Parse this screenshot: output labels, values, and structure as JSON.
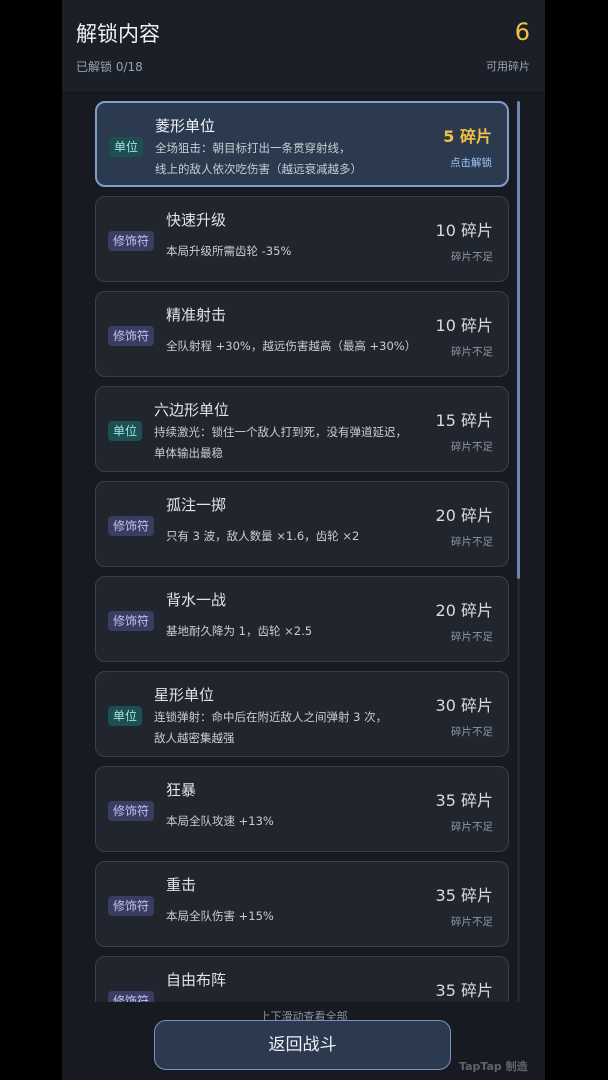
{
  "header": {
    "title": "解锁内容",
    "progress": "已解锁 0/18",
    "shards": "6",
    "shards_label": "可用碎片"
  },
  "items": [
    {
      "type": "单位",
      "name": "菱形单位",
      "desc1": "全场狙击：朝目标打出一条贯穿射线，",
      "desc2": "线上的敌人依次吃伤害（越远衰减越多）",
      "cost": "5 碎片",
      "status": "点击解锁"
    },
    {
      "type": "修饰符",
      "name": "快速升级",
      "desc1": "本局升级所需齿轮 -35%",
      "desc2": "",
      "cost": "10 碎片",
      "status": "碎片不足"
    },
    {
      "type": "修饰符",
      "name": "精准射击",
      "desc1": "全队射程 +30%，越远伤害越高（最高 +30%）",
      "desc2": "",
      "cost": "10 碎片",
      "status": "碎片不足"
    },
    {
      "type": "单位",
      "name": "六边形单位",
      "desc1": "持续激光：锁住一个敌人打到死，没有弹道延迟，",
      "desc2": "单体输出最稳",
      "cost": "15 碎片",
      "status": "碎片不足"
    },
    {
      "type": "修饰符",
      "name": "孤注一掷",
      "desc1": "只有 3 波，敌人数量 ×1.6，齿轮 ×2",
      "desc2": "",
      "cost": "20 碎片",
      "status": "碎片不足"
    },
    {
      "type": "修饰符",
      "name": "背水一战",
      "desc1": "基地耐久降为 1，齿轮 ×2.5",
      "desc2": "",
      "cost": "20 碎片",
      "status": "碎片不足"
    },
    {
      "type": "单位",
      "name": "星形单位",
      "desc1": "连锁弹射：命中后在附近敌人之间弹射 3 次，",
      "desc2": "敌人越密集越强",
      "cost": "30 碎片",
      "status": "碎片不足"
    },
    {
      "type": "修饰符",
      "name": "狂暴",
      "desc1": "本局全队攻速 +13%",
      "desc2": "",
      "cost": "35 碎片",
      "status": "碎片不足"
    },
    {
      "type": "修饰符",
      "name": "重击",
      "desc1": "本局全队伤害 +15%",
      "desc2": "",
      "cost": "35 碎片",
      "status": "碎片不足"
    },
    {
      "type": "修饰符",
      "name": "自由布阵",
      "desc1": "",
      "desc2": "",
      "cost": "35 碎片",
      "status": ""
    }
  ],
  "footer": {
    "hint": "上下滑动查看全部",
    "return_label": "返回战斗",
    "watermark": "TapTap 制造"
  }
}
